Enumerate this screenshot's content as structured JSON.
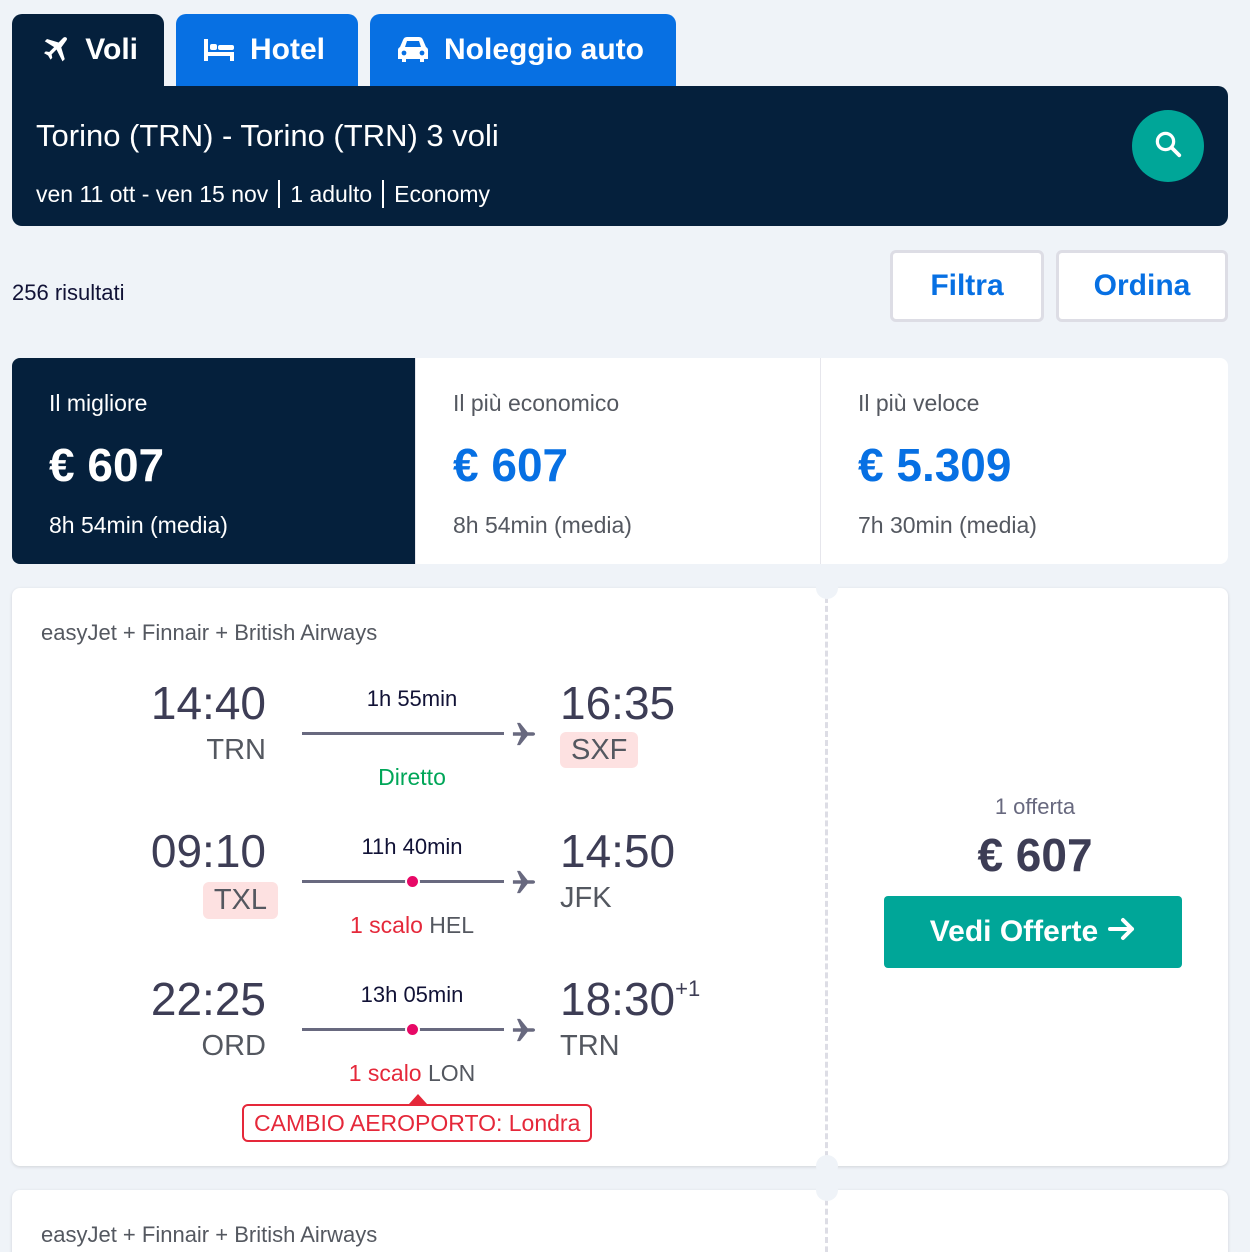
{
  "tabs": [
    {
      "label": "Voli",
      "icon": "plane-icon",
      "active": true
    },
    {
      "label": "Hotel",
      "icon": "bed-icon",
      "active": false
    },
    {
      "label": "Noleggio auto",
      "icon": "car-icon",
      "active": false
    }
  ],
  "search": {
    "route": "Torino (TRN) - Torino (TRN) 3 voli",
    "dates": "ven 11 ott - ven 15 nov",
    "travellers": "1 adulto",
    "cabin": "Economy",
    "icon": "search-icon"
  },
  "results": {
    "count_label": "256 risultati",
    "filter_label": "Filtra",
    "sort_label": "Ordina"
  },
  "summary": [
    {
      "label": "Il migliore",
      "price": "€ 607",
      "sub": "8h 54min (media)",
      "active": true
    },
    {
      "label": "Il più economico",
      "price": "€ 607",
      "sub": "8h 54min (media)",
      "active": false
    },
    {
      "label": "Il più veloce",
      "price": "€ 5.309",
      "sub": "7h 30min (media)",
      "active": false
    }
  ],
  "flight": {
    "airlines": "easyJet + Finnair + British Airways",
    "legs": [
      {
        "dep_time": "14:40",
        "dep_code": "TRN",
        "arr_time": "16:35",
        "arr_code": "SXF",
        "duration": "1h 55min",
        "stops_label": "Diretto",
        "stop_airport": ""
      },
      {
        "dep_time": "09:10",
        "dep_code": "TXL",
        "arr_time": "14:50",
        "arr_code": "JFK",
        "duration": "11h 40min",
        "stops_label": "1 scalo",
        "stop_airport": "HEL"
      },
      {
        "dep_time": "22:25",
        "dep_code": "ORD",
        "arr_time": "18:30",
        "arr_day_offset": "+1",
        "arr_code": "TRN",
        "duration": "13h 05min",
        "stops_label": "1 scalo",
        "stop_airport": "LON"
      }
    ],
    "warning": "CAMBIO AEROPORTO: Londra",
    "offer_count": "1 offerta",
    "price": "€ 607",
    "cta_label": "Vedi Offerte"
  },
  "flight2": {
    "airlines": "easyJet + Finnair + British Airways"
  },
  "colors": {
    "navy": "#05203c",
    "blue": "#0770e3",
    "teal": "#00a698",
    "green": "#00a658",
    "red": "#e5283a",
    "highlight": "#fde1e1"
  }
}
